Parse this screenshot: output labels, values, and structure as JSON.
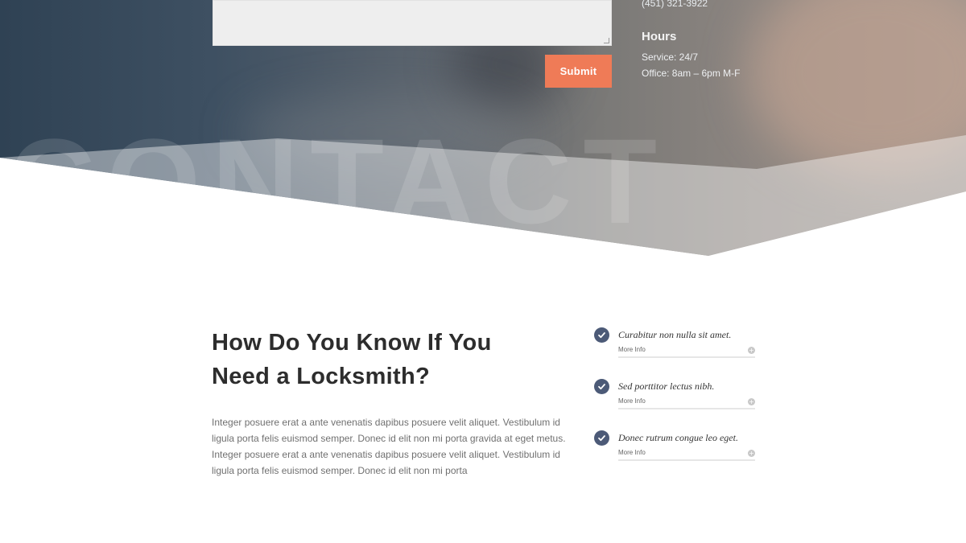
{
  "contact": {
    "watermark": "CONTACT",
    "submit_label": "Submit",
    "phone": "(451) 321-3922",
    "hours_title": "Hours",
    "hours_service": "Service: 24/7",
    "hours_office": "Office: 8am – 6pm M-F"
  },
  "info": {
    "heading_line1": "How Do You Know If You",
    "heading_line2": "Need a Locksmith?",
    "paragraph": "Integer posuere erat a ante venenatis dapibus posuere velit aliquet. Vestibulum id ligula porta felis euismod semper. Donec id elit non mi porta gravida at eget metus. Integer posuere erat a ante venenatis dapibus posuere velit aliquet. Vestibulum id ligula porta felis euismod semper. Donec id elit non mi porta"
  },
  "features": [
    {
      "title": "Curabitur non nulla sit amet.",
      "more_label": "More Info"
    },
    {
      "title": "Sed porttitor lectus nibh.",
      "more_label": "More Info"
    },
    {
      "title": "Donec rutrum congue leo eget.",
      "more_label": "More Info"
    }
  ],
  "icons": {
    "check": "check-circle-icon",
    "plus": "plus-circle-icon"
  },
  "colors": {
    "accent": "#ef7b57",
    "check_bg": "#4c5a77",
    "heading": "#2d2d2d"
  }
}
